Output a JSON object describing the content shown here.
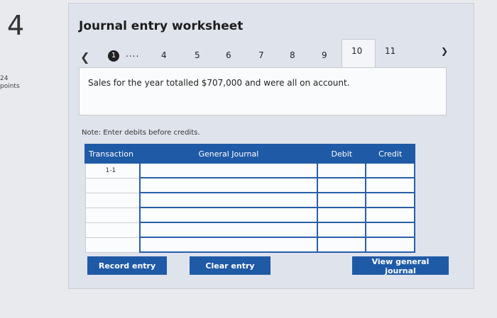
{
  "question": {
    "number": "4",
    "points_value": "24",
    "points_label": "points"
  },
  "worksheet": {
    "title": "Journal entry worksheet",
    "pager": {
      "prev_icon": "chevron-left-icon",
      "current": "1",
      "ellipsis": "....",
      "pages": [
        "4",
        "5",
        "6",
        "7",
        "8",
        "9",
        "10",
        "11"
      ],
      "active_tab": "10",
      "next_icon": "chevron-right-icon"
    },
    "description": "Sales for the year totalled $707,000 and were all on account.",
    "note": "Note: Enter debits before credits.",
    "table": {
      "headers": [
        "Transaction",
        "General Journal",
        "Debit",
        "Credit"
      ],
      "rows": [
        {
          "transaction": "1-1",
          "account": "",
          "debit": "",
          "credit": ""
        },
        {
          "transaction": "",
          "account": "",
          "debit": "",
          "credit": ""
        },
        {
          "transaction": "",
          "account": "",
          "debit": "",
          "credit": ""
        },
        {
          "transaction": "",
          "account": "",
          "debit": "",
          "credit": ""
        },
        {
          "transaction": "",
          "account": "",
          "debit": "",
          "credit": ""
        },
        {
          "transaction": "",
          "account": "",
          "debit": "",
          "credit": ""
        }
      ]
    },
    "buttons": {
      "record": "Record entry",
      "clear": "Clear entry",
      "view": "View general journal"
    }
  },
  "colors": {
    "accent": "#1f5aa6",
    "panel": "#dfe3ec"
  }
}
